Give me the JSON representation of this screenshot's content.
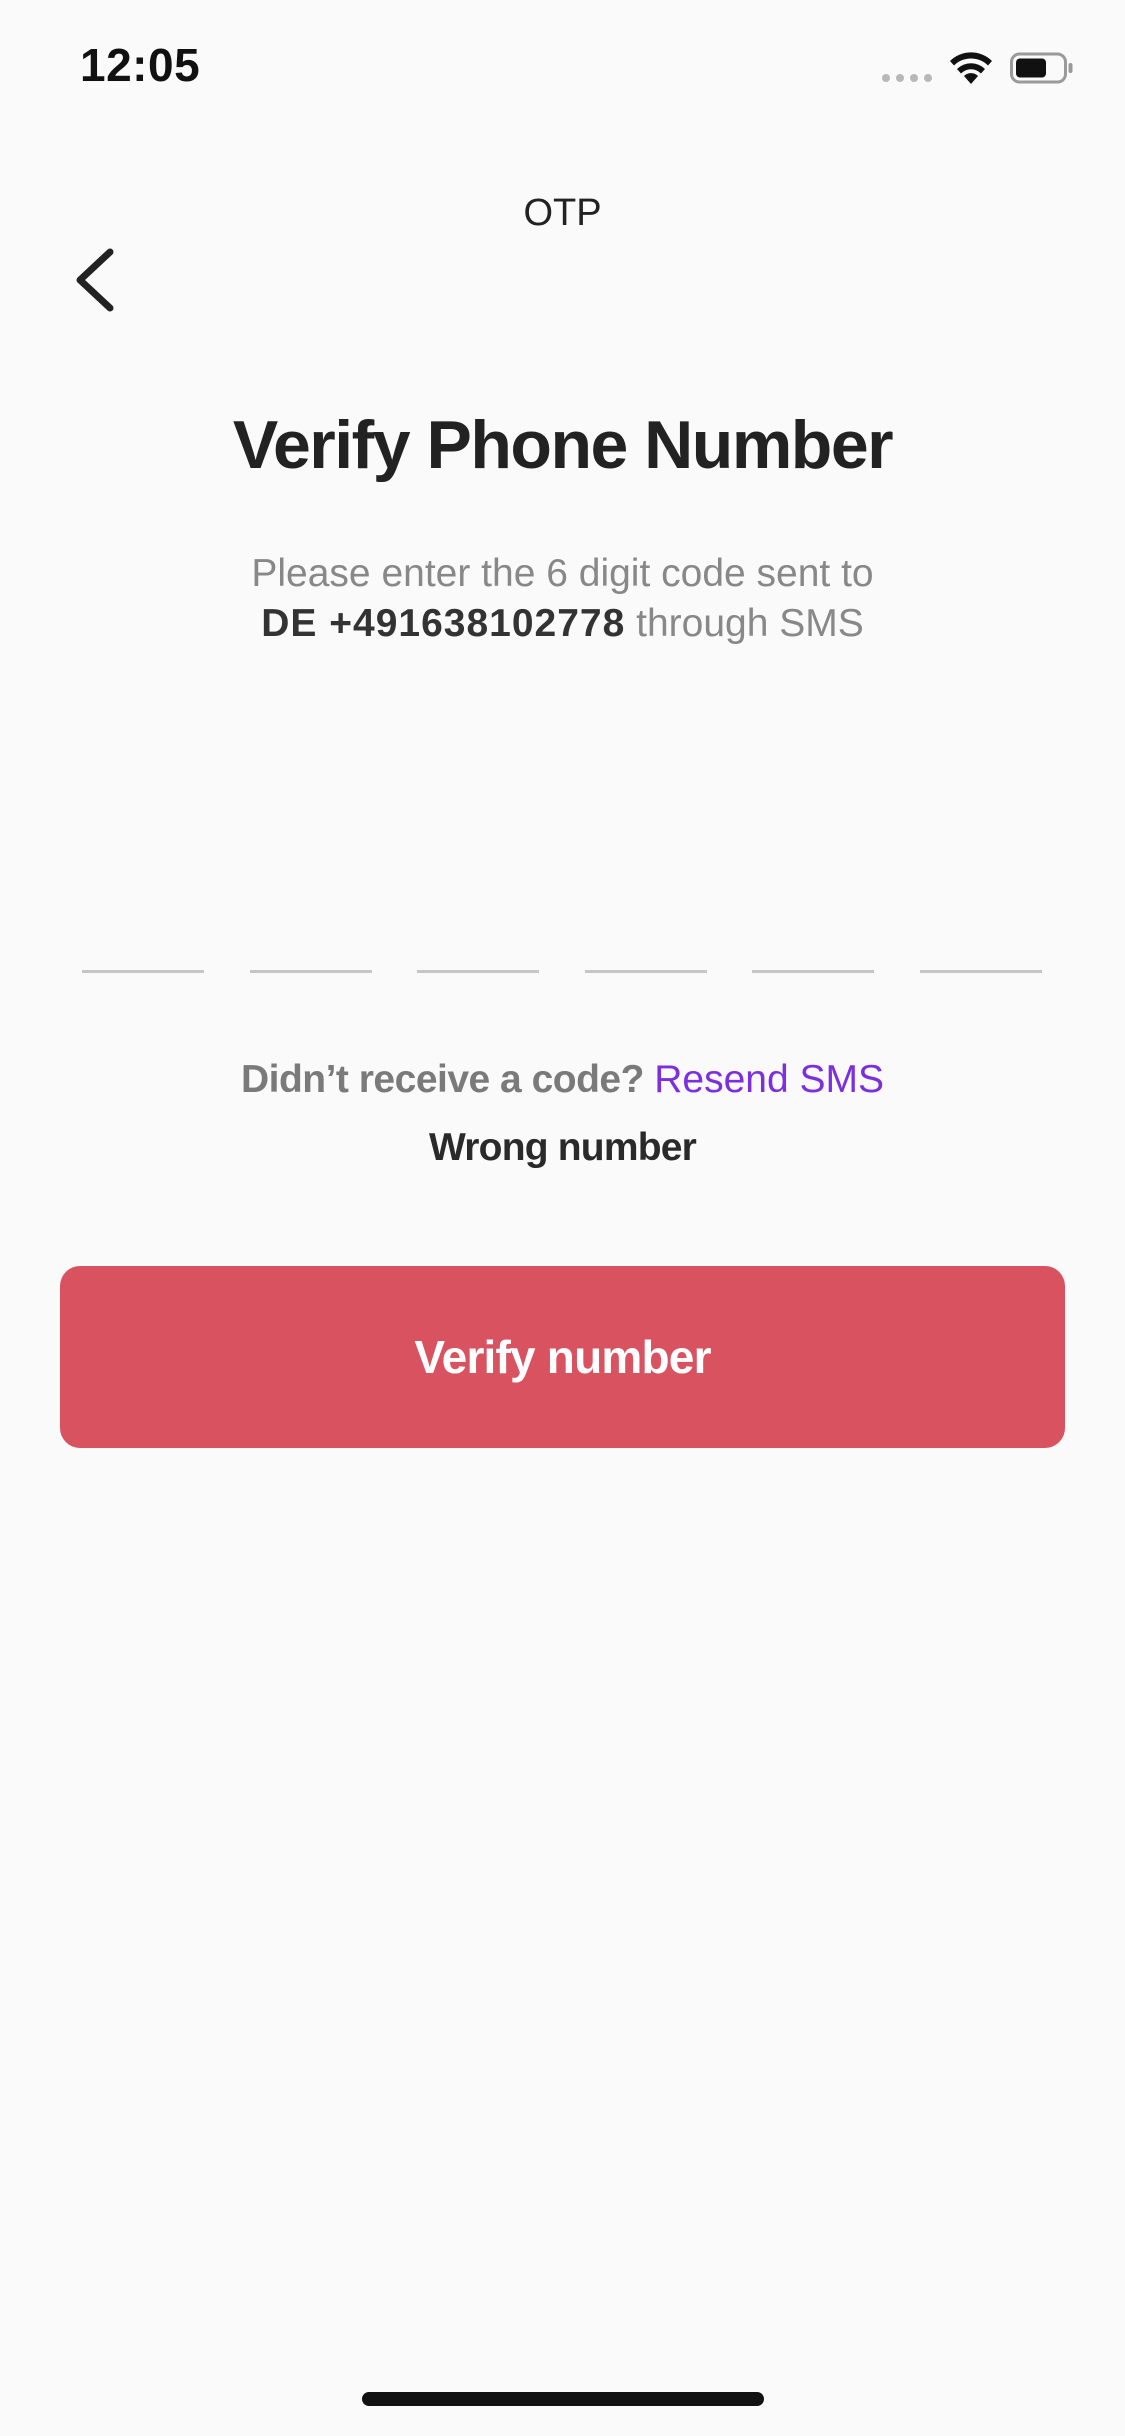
{
  "status_bar": {
    "time": "12:05"
  },
  "nav": {
    "title": "OTP",
    "back_icon": "chevron-left-icon"
  },
  "heading": "Verify Phone Number",
  "subtitle": {
    "line1": "Please enter the 6 digit code sent to",
    "phone": "DE +491638102778",
    "suffix": " through SMS"
  },
  "otp": {
    "digits": [
      "",
      "",
      "",
      "",
      "",
      ""
    ]
  },
  "resend": {
    "question": "Didn’t receive a code? ",
    "link": "Resend SMS"
  },
  "wrong_number": "Wrong number",
  "verify_button": "Verify number",
  "colors": {
    "background": "#fafafa",
    "primary_button": "#d85260",
    "link": "#7b2fe0",
    "muted_text": "#888888"
  }
}
